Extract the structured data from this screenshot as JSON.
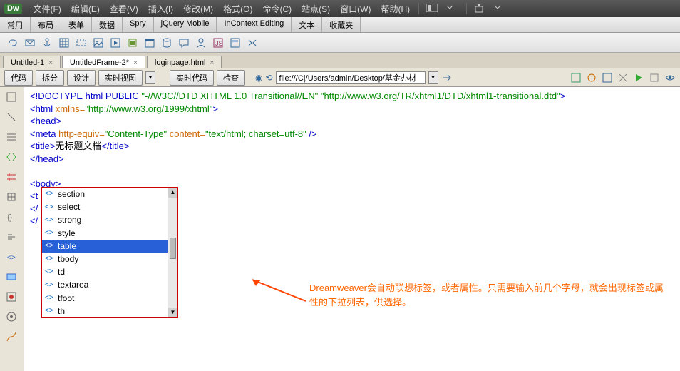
{
  "menubar": {
    "logo": "Dw",
    "items": [
      "文件(F)",
      "编辑(E)",
      "查看(V)",
      "插入(I)",
      "修改(M)",
      "格式(O)",
      "命令(C)",
      "站点(S)",
      "窗口(W)",
      "帮助(H)"
    ]
  },
  "categories": [
    "常用",
    "布局",
    "表单",
    "数据",
    "Spry",
    "jQuery Mobile",
    "InContext Editing",
    "文本",
    "收藏夹"
  ],
  "doctabs": [
    {
      "label": "Untitled-1",
      "close": "×",
      "active": false
    },
    {
      "label": "UntitledFrame-2*",
      "close": "×",
      "active": true
    },
    {
      "label": "loginpage.html",
      "close": "×",
      "active": false
    }
  ],
  "viewbar": {
    "btns": [
      "代码",
      "拆分",
      "设计",
      "实时视图"
    ],
    "btns2": [
      "实时代码",
      "检查"
    ],
    "globe": "◉",
    "addr_label": "⟲",
    "addr": "file:///C|/Users/admin/Desktop/基金办材"
  },
  "code": {
    "l1": {
      "a": "<!DOCTYPE html PUBLIC ",
      "b": "\"-//W3C//DTD XHTML 1.0 Transitional//EN\"",
      "c": " ",
      "d": "\"http://www.w3.org/TR/xhtml1/DTD/xhtml1-transitional.dtd\"",
      "e": ">"
    },
    "l2": {
      "a": "<html ",
      "b": "xmlns=",
      "c": "\"http://www.w3.org/1999/xhtml\"",
      "d": ">"
    },
    "l3": "<head>",
    "l4": {
      "a": "<meta ",
      "b": "http-equiv=",
      "c": "\"Content-Type\"",
      "d": " content=",
      "e": "\"text/html; charset=utf-8\"",
      "f": " />"
    },
    "l5": {
      "a": "<title>",
      "b": "无标题文档",
      "c": "</title>"
    },
    "l6": "</head>",
    "l7": "<body>",
    "l8": "<t",
    "l9": "</",
    "l10": "</"
  },
  "autocomplete": {
    "items": [
      "section",
      "select",
      "strong",
      "style",
      "table",
      "tbody",
      "td",
      "textarea",
      "tfoot",
      "th"
    ],
    "selected_index": 4
  },
  "annotation": {
    "line1": "Dreamweaver会自动联想标签，或者属性。只需要输入前几个字母，就会出现标签或属性的下拉列表，供选择。"
  }
}
